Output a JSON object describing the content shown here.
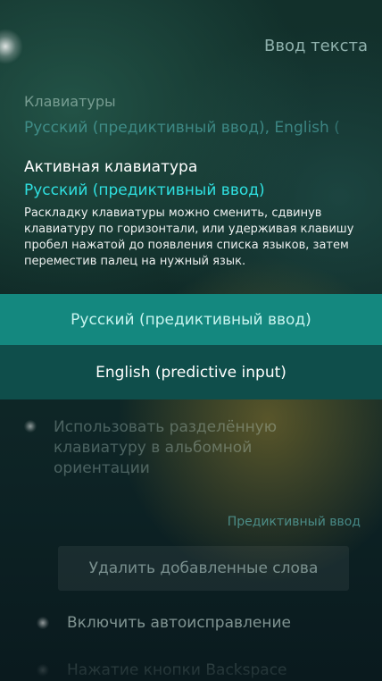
{
  "header": {
    "title": "Ввод текста"
  },
  "keyboards": {
    "label": "Клавиатуры",
    "value": "Русский (предиктивный ввод), English ("
  },
  "active_keyboard": {
    "label": "Активная клавиатура",
    "value": "Русский (предиктивный ввод)",
    "hint": "Раскладку клавиатуры можно сменить, сдвинув клавиатуру по горизонтали, или удерживая клавишу пробел нажатой до появления списка языков, затем переместив палец на нужный язык."
  },
  "options": [
    {
      "label": "Русский (предиктивный ввод)",
      "selected": true
    },
    {
      "label": "English (predictive input)",
      "selected": false
    }
  ],
  "split_keyboard": {
    "label": "Использовать разделённую клавиатуру в альбомной ориентации"
  },
  "predictive_section": {
    "title": "Предиктивный ввод"
  },
  "delete_words": {
    "label": "Удалить добавленные слова"
  },
  "autocorrect": {
    "label": "Включить автоисправление"
  },
  "backspace": {
    "label": "Нажатие кнопки Backspace"
  },
  "colors": {
    "accent": "#2fe0e0",
    "selected_bg": "#14887f",
    "option_bg": "#0f4e4b"
  }
}
